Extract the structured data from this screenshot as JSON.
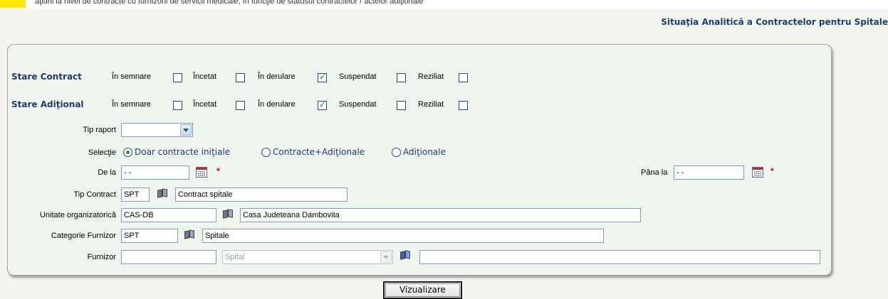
{
  "top_clip_text": "  ăţiuni la nivel de contracte cu furnizorii de servicii medicale, în funcţie de statusul contractelor / actelor adiţionale",
  "page_title": "Situaţia Analitică a Contractelor pentru Spitale",
  "stare_contract": {
    "label": "Stare Contract",
    "options": [
      {
        "label": "În semnare",
        "checked": false
      },
      {
        "label": "Încetat",
        "checked": false
      },
      {
        "label": "În derulare",
        "checked": true
      },
      {
        "label": "Suspendat",
        "checked": false
      },
      {
        "label": "Reziliat",
        "checked": false
      }
    ]
  },
  "stare_aditional": {
    "label": "Stare Adiţional",
    "options": [
      {
        "label": "În semnare",
        "checked": false
      },
      {
        "label": "Încetat",
        "checked": false
      },
      {
        "label": "În derulare",
        "checked": true
      },
      {
        "label": "Suspendat",
        "checked": false
      },
      {
        "label": "Reziliat",
        "checked": false
      }
    ]
  },
  "tip_raport": {
    "label": "Tip raport",
    "value": ""
  },
  "selectie": {
    "label": "Selecţie",
    "options": [
      {
        "label": "Doar contracte iniţiale",
        "selected": true
      },
      {
        "label": "Contracte+Adiţionale",
        "selected": false
      },
      {
        "label": "Adiţionale",
        "selected": false
      }
    ]
  },
  "de_la": {
    "label": "De la",
    "value": "  -   -"
  },
  "pana_la": {
    "label": "Pâna la",
    "value": "  -   -"
  },
  "required_mark": "*",
  "tip_contract": {
    "label": "Tip Contract",
    "code": "SPT",
    "name": "Contract spitale"
  },
  "unitate": {
    "label": "Unitate organizatorică",
    "code": "CAS-DB",
    "name": "Casa Judeteana Dambovita"
  },
  "categorie": {
    "label": "Categorie Furnizor",
    "code": "SPT",
    "name": "Spitale"
  },
  "furnizor": {
    "label": "Furnizor",
    "code": "",
    "type": "Spital",
    "name": ""
  },
  "buttons": {
    "vizualizare": "Vizualizare"
  },
  "icons": {
    "calendar": "calendar-icon",
    "lookup": "book-lookup-icon",
    "dropdown": "chevron-down-icon"
  }
}
